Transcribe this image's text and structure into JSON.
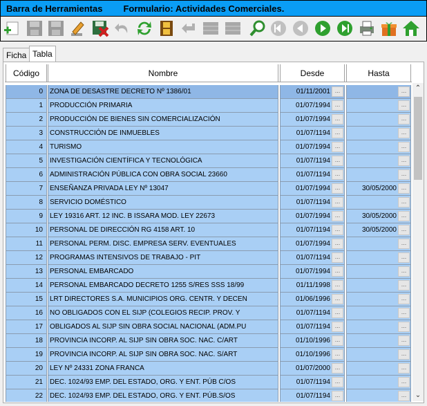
{
  "title": {
    "left": "Barra de Herramientas",
    "right": "Formulario: Actividades Comerciales."
  },
  "toolbar": [
    {
      "icon": "add-icon"
    },
    {
      "icon": "save-icon"
    },
    {
      "icon": "save-as-icon"
    },
    {
      "icon": "edit-icon"
    },
    {
      "icon": "delete-save-icon"
    },
    {
      "icon": "undo-icon"
    },
    {
      "icon": "refresh-icon"
    },
    {
      "icon": "film-icon"
    },
    {
      "icon": "back-arrow-icon"
    },
    {
      "icon": "grid-icon"
    },
    {
      "icon": "grid-alt-icon"
    },
    {
      "icon": "search-icon"
    },
    {
      "icon": "first-icon"
    },
    {
      "icon": "prev-icon"
    },
    {
      "icon": "next-icon"
    },
    {
      "icon": "last-icon"
    },
    {
      "icon": "print-icon"
    },
    {
      "icon": "gift-icon"
    },
    {
      "icon": "home-icon"
    }
  ],
  "tabs": [
    {
      "label": "Ficha"
    },
    {
      "label": "Tabla",
      "active": true
    }
  ],
  "grid": {
    "headers": {
      "code": "Código",
      "name": "Nombre",
      "desde": "Desde",
      "hasta": "Hasta"
    },
    "ellipsis": "...",
    "rows": [
      {
        "code": "0",
        "name": "ZONA DE DESASTRE DECRETO Nº 1386/01",
        "desde": "01/11/2001",
        "hasta": ""
      },
      {
        "code": "1",
        "name": "PRODUCCIÓN PRIMARIA",
        "desde": "01/07/1994",
        "hasta": ""
      },
      {
        "code": "2",
        "name": "PRODUCCIÓN DE BIENES SIN COMERCIALIZACIÓN",
        "desde": "01/07/1994",
        "hasta": ""
      },
      {
        "code": "3",
        "name": "CONSTRUCCIÓN DE INMUEBLES",
        "desde": "01/07/1194",
        "hasta": ""
      },
      {
        "code": "4",
        "name": "TURISMO",
        "desde": "01/07/1994",
        "hasta": ""
      },
      {
        "code": "5",
        "name": "INVESTIGACIÓN CIENTÍFICA Y TECNOLÓGICA",
        "desde": "01/07/1194",
        "hasta": ""
      },
      {
        "code": "6",
        "name": "ADMINISTRACIÓN PÚBLICA CON OBRA SOCIAL 23660",
        "desde": "01/07/1194",
        "hasta": ""
      },
      {
        "code": "7",
        "name": "ENSEÑANZA PRIVADA LEY Nº 13047",
        "desde": "01/07/1994",
        "hasta": "30/05/2000"
      },
      {
        "code": "8",
        "name": "SERVICIO DOMÉSTICO",
        "desde": "01/07/1194",
        "hasta": ""
      },
      {
        "code": "9",
        "name": "LEY 19316 ART. 12 INC. B ISSARA MOD. LEY 22673",
        "desde": "01/07/1994",
        "hasta": "30/05/2000"
      },
      {
        "code": "10",
        "name": "PERSONAL DE DIRECCIÓN RG 4158 ART. 10",
        "desde": "01/07/1194",
        "hasta": "30/05/2000"
      },
      {
        "code": "11",
        "name": "PERSONAL PERM. DISC. EMPRESA SERV. EVENTUALES",
        "desde": "01/07/1994",
        "hasta": ""
      },
      {
        "code": "12",
        "name": "PROGRAMAS INTENSIVOS DE TRABAJO - PIT",
        "desde": "01/07/1194",
        "hasta": ""
      },
      {
        "code": "13",
        "name": "PERSONAL EMBARCADO",
        "desde": "01/07/1994",
        "hasta": ""
      },
      {
        "code": "14",
        "name": "PERSONAL EMBARCADO DECRETO 1255 S/RES SSS 18/99",
        "desde": "01/11/1998",
        "hasta": ""
      },
      {
        "code": "15",
        "name": "LRT DIRECTORES S.A. MUNICIPIOS ORG. CENTR. Y DECEN",
        "desde": "01/06/1996",
        "hasta": ""
      },
      {
        "code": "16",
        "name": "NO OBLIGADOS CON EL SIJP (COLEGIOS RECIP. PROV. Y",
        "desde": "01/07/1194",
        "hasta": ""
      },
      {
        "code": "17",
        "name": "OBLIGADOS AL SIJP SIN OBRA SOCIAL NACIONAL (ADM.PU",
        "desde": "01/07/1194",
        "hasta": ""
      },
      {
        "code": "18",
        "name": "PROVINCIA INCORP. AL SIJP SIN OBRA SOC. NAC. C/ART",
        "desde": "01/10/1996",
        "hasta": ""
      },
      {
        "code": "19",
        "name": "PROVINCIA INCORP. AL SIJP SIN OBRA SOC. NAC. S/ART",
        "desde": "01/10/1996",
        "hasta": ""
      },
      {
        "code": "20",
        "name": "LEY Nº 24331 ZONA FRANCA",
        "desde": "01/07/2000",
        "hasta": ""
      },
      {
        "code": "21",
        "name": "DEC. 1024/93 EMP. DEL ESTADO, ORG. Y ENT. PÚB C/OS",
        "desde": "01/07/1194",
        "hasta": ""
      },
      {
        "code": "22",
        "name": "DEC. 1024/93 EMP. DEL ESTADO, ORG. Y ENT. PÚB.S/OS",
        "desde": "01/07/1194",
        "hasta": ""
      }
    ]
  }
}
